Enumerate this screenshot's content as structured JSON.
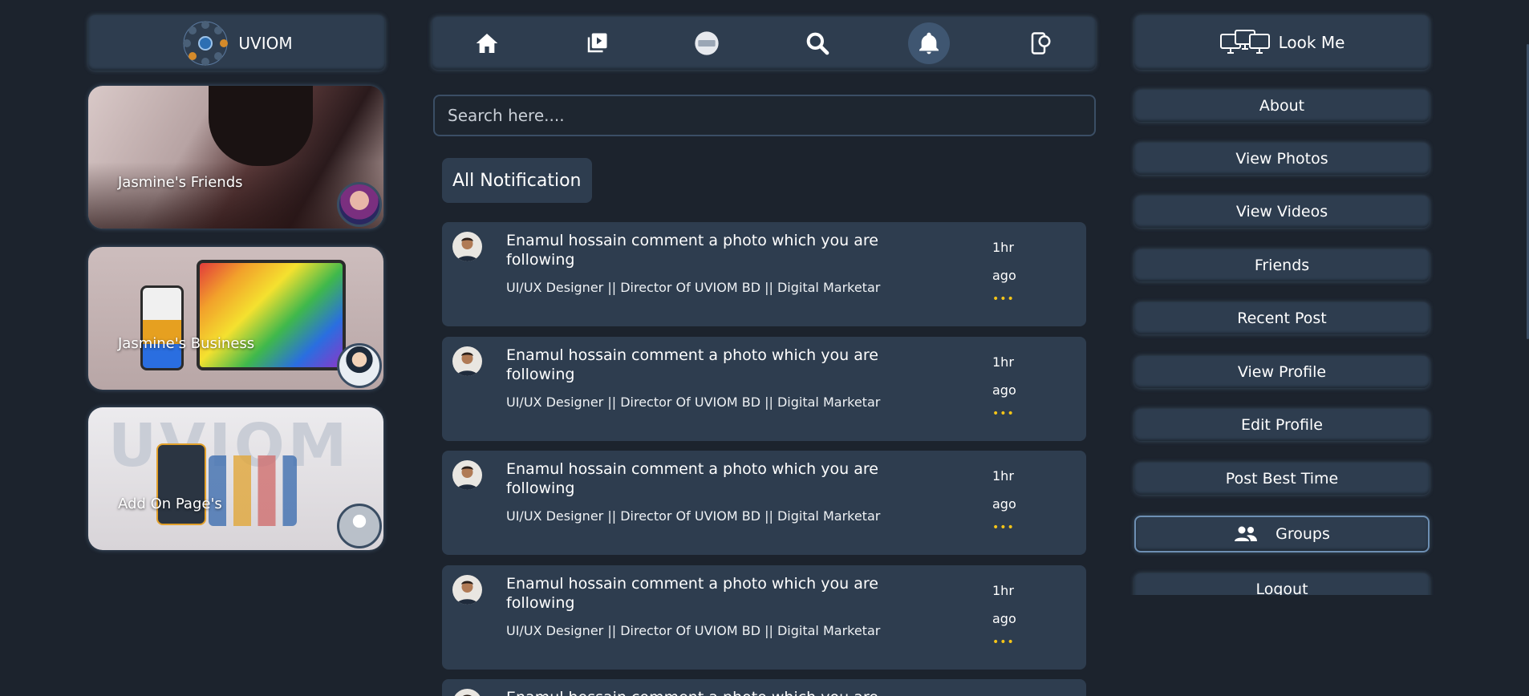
{
  "brand": {
    "name": "UVIOM"
  },
  "left_cards": [
    {
      "label": "Jasmine's Friends"
    },
    {
      "label": "Jasmine's Business"
    },
    {
      "label": "Add On Page's",
      "art_text": "UVIOM"
    }
  ],
  "nav": {
    "icons": [
      "home-icon",
      "video-playlist-icon",
      "badge-icon",
      "search-icon",
      "bell-icon",
      "phone-chat-icon"
    ],
    "active": "bell-icon"
  },
  "search": {
    "placeholder": "Search here...."
  },
  "section_title": "All Notification",
  "notifications": [
    {
      "title": "Enamul hossain comment a photo which you are following",
      "subtitle": "UI/UX Designer || Director Of UVIOM BD || Digital Marketar",
      "time": "1hr ago",
      "more": "•••"
    },
    {
      "title": "Enamul hossain comment a photo which you are following",
      "subtitle": "UI/UX Designer || Director Of UVIOM BD || Digital Marketar",
      "time": "1hr ago",
      "more": "•••"
    },
    {
      "title": "Enamul hossain comment a photo which you are following",
      "subtitle": "UI/UX Designer || Director Of UVIOM BD || Digital Marketar",
      "time": "1hr ago",
      "more": "•••"
    },
    {
      "title": "Enamul hossain comment a photo which you are following",
      "subtitle": "UI/UX Designer || Director Of UVIOM BD || Digital Marketar",
      "time": "1hr ago",
      "more": "•••"
    },
    {
      "title": "Enamul hossain comment a photo which you are following",
      "subtitle": "",
      "time": "",
      "more": ""
    }
  ],
  "right_menu": {
    "header": "Look Me",
    "items": [
      "About",
      "View Photos",
      "View Videos",
      "Friends",
      "Recent Post",
      "View Profile",
      "Edit Profile",
      "Post Best Time",
      "Groups",
      "Logout"
    ]
  },
  "colors": {
    "background": "#1c232d",
    "panel": "#2e3d4f",
    "accent": "#f5c518"
  }
}
